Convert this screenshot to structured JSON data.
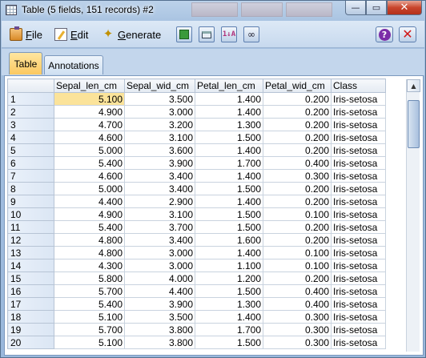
{
  "window": {
    "title": "Table (5 fields, 151 records) #2",
    "buttons": {
      "minimize": "—",
      "maximize": "▭",
      "close": "✕"
    }
  },
  "menu": {
    "file": {
      "underline": "F",
      "rest": "ile"
    },
    "edit": {
      "underline": "E",
      "rest": "dit"
    },
    "generate": {
      "underline": "G",
      "rest": "enerate"
    }
  },
  "toolbar": {
    "icons": [
      "export-icon",
      "print-icon",
      "sort-icon",
      "find-icon"
    ],
    "sort_glyph": "1↓A",
    "help_glyph": "?",
    "close_glyph": "✕"
  },
  "tabs": [
    {
      "label": "Table",
      "active": true
    },
    {
      "label": "Annotations",
      "active": false
    }
  ],
  "table": {
    "columns": [
      "",
      "Sepal_len_cm",
      "Sepal_wid_cm",
      "Petal_len_cm",
      "Petal_wid_cm",
      "Class"
    ],
    "rows": [
      [
        "1",
        "5.100",
        "3.500",
        "1.400",
        "0.200",
        "Iris-setosa"
      ],
      [
        "2",
        "4.900",
        "3.000",
        "1.400",
        "0.200",
        "Iris-setosa"
      ],
      [
        "3",
        "4.700",
        "3.200",
        "1.300",
        "0.200",
        "Iris-setosa"
      ],
      [
        "4",
        "4.600",
        "3.100",
        "1.500",
        "0.200",
        "Iris-setosa"
      ],
      [
        "5",
        "5.000",
        "3.600",
        "1.400",
        "0.200",
        "Iris-setosa"
      ],
      [
        "6",
        "5.400",
        "3.900",
        "1.700",
        "0.400",
        "Iris-setosa"
      ],
      [
        "7",
        "4.600",
        "3.400",
        "1.400",
        "0.300",
        "Iris-setosa"
      ],
      [
        "8",
        "5.000",
        "3.400",
        "1.500",
        "0.200",
        "Iris-setosa"
      ],
      [
        "9",
        "4.400",
        "2.900",
        "1.400",
        "0.200",
        "Iris-setosa"
      ],
      [
        "10",
        "4.900",
        "3.100",
        "1.500",
        "0.100",
        "Iris-setosa"
      ],
      [
        "11",
        "5.400",
        "3.700",
        "1.500",
        "0.200",
        "Iris-setosa"
      ],
      [
        "12",
        "4.800",
        "3.400",
        "1.600",
        "0.200",
        "Iris-setosa"
      ],
      [
        "13",
        "4.800",
        "3.000",
        "1.400",
        "0.100",
        "Iris-setosa"
      ],
      [
        "14",
        "4.300",
        "3.000",
        "1.100",
        "0.100",
        "Iris-setosa"
      ],
      [
        "15",
        "5.800",
        "4.000",
        "1.200",
        "0.200",
        "Iris-setosa"
      ],
      [
        "16",
        "5.700",
        "4.400",
        "1.500",
        "0.400",
        "Iris-setosa"
      ],
      [
        "17",
        "5.400",
        "3.900",
        "1.300",
        "0.400",
        "Iris-setosa"
      ],
      [
        "18",
        "5.100",
        "3.500",
        "1.400",
        "0.300",
        "Iris-setosa"
      ],
      [
        "19",
        "5.700",
        "3.800",
        "1.700",
        "0.300",
        "Iris-setosa"
      ],
      [
        "20",
        "5.100",
        "3.800",
        "1.500",
        "0.300",
        "Iris-setosa"
      ]
    ],
    "selected_cell": {
      "row": 0,
      "col": 1
    }
  },
  "colors": {
    "selection": "#fbe39a",
    "active_tab": "#fbc860"
  }
}
